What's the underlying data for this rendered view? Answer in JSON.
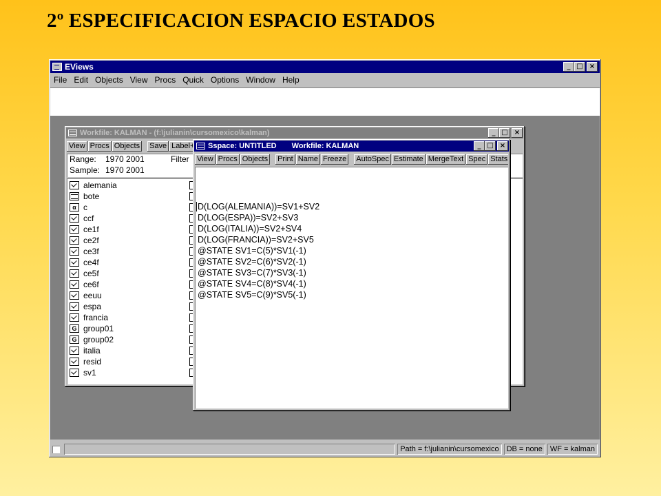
{
  "slide": {
    "title": "2º ESPECIFICACION ESPACIO ESTADOS"
  },
  "app": {
    "title": "EViews",
    "window_buttons": {
      "minimize": "_",
      "maximize": "□",
      "close": "×"
    },
    "menu": [
      "File",
      "Edit",
      "Objects",
      "View",
      "Procs",
      "Quick",
      "Options",
      "Window",
      "Help"
    ],
    "status": {
      "path": "Path = f:\\julianin\\cursomexico",
      "db": "DB = none",
      "wf": "WF = kalman"
    }
  },
  "workfile": {
    "title": "Workfile: KALMAN - (f:\\julianin\\cursomexico\\kalman)",
    "toolbar": [
      "View",
      "Procs",
      "Objects",
      "Save",
      "Label+"
    ],
    "range_label": "Range:",
    "range_value": "1970 2001",
    "filter_label": "Filter",
    "sample_label": "Sample:",
    "sample_value": "1970 2001",
    "objects": [
      {
        "name": "alemania",
        "type": "series"
      },
      {
        "name": "bote",
        "type": "table"
      },
      {
        "name": "c",
        "type": "coef"
      },
      {
        "name": "ccf",
        "type": "series"
      },
      {
        "name": "ce1f",
        "type": "series"
      },
      {
        "name": "ce2f",
        "type": "series"
      },
      {
        "name": "ce3f",
        "type": "series"
      },
      {
        "name": "ce4f",
        "type": "series"
      },
      {
        "name": "ce5f",
        "type": "series"
      },
      {
        "name": "ce6f",
        "type": "series"
      },
      {
        "name": "eeuu",
        "type": "series"
      },
      {
        "name": "espa",
        "type": "series"
      },
      {
        "name": "francia",
        "type": "series"
      },
      {
        "name": "group01",
        "type": "group"
      },
      {
        "name": "group02",
        "type": "group"
      },
      {
        "name": "italia",
        "type": "series"
      },
      {
        "name": "resid",
        "type": "series"
      },
      {
        "name": "sv1",
        "type": "series"
      }
    ],
    "icon_glyphs": {
      "coef": "α",
      "group": "G"
    }
  },
  "sspace": {
    "title": "Sspace: UNTITLED",
    "workfile": "Workfile: KALMAN",
    "toolbar_group1": [
      "View",
      "Procs",
      "Objects"
    ],
    "toolbar_group2": [
      "Print",
      "Name",
      "Freeze"
    ],
    "toolbar_group3": [
      "AutoSpec",
      "Estimate",
      "MergeText",
      "Spec",
      "Stats",
      "I"
    ],
    "lines": [
      "D(LOG(ALEMANIA))=SV1+SV2",
      "D(LOG(ESPA))=SV2+SV3",
      "D(LOG(ITALIA))=SV2+SV4",
      "D(LOG(FRANCIA))=SV2+SV5",
      "@STATE SV1=C(5)*SV1(-1)",
      "@STATE SV2=C(6)*SV2(-1)",
      "@STATE SV3=C(7)*SV3(-1)",
      "@STATE SV4=C(8)*SV4(-1)",
      "@STATE SV5=C(9)*SV5(-1)"
    ]
  }
}
